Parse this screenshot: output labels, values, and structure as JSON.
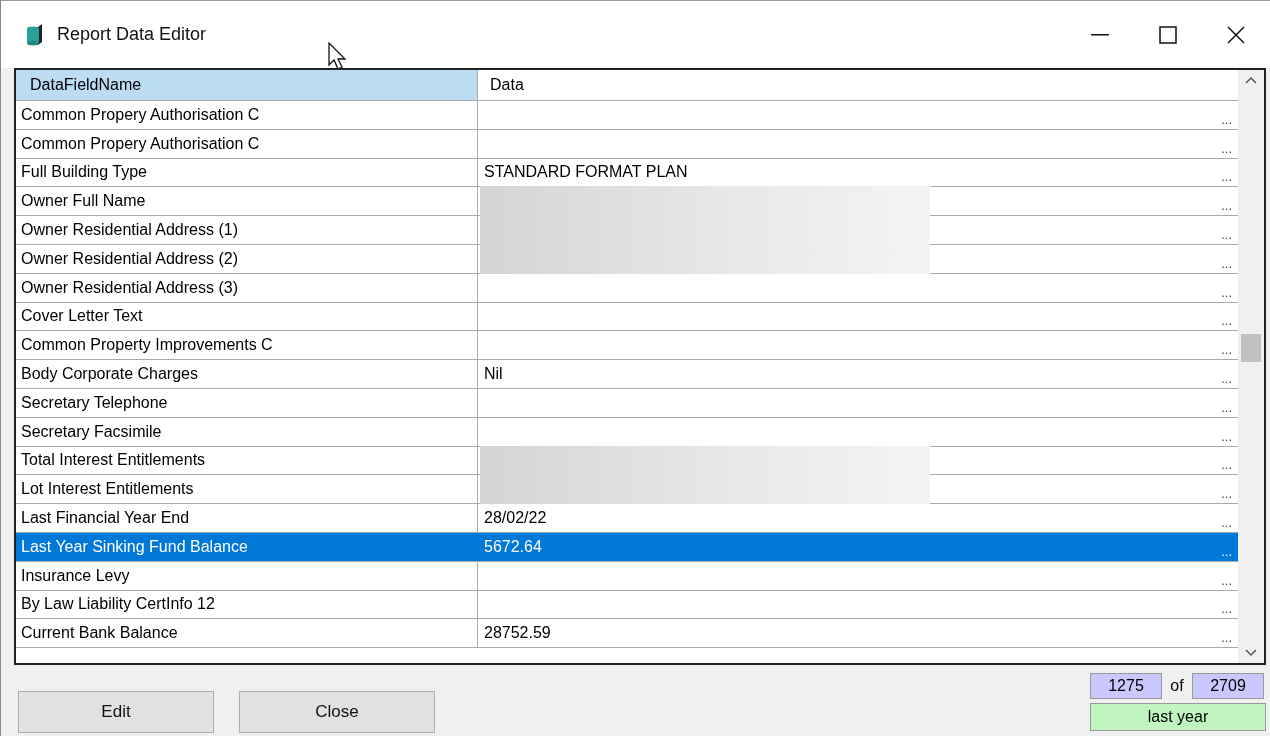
{
  "window": {
    "title": "Report Data Editor"
  },
  "table": {
    "columns": [
      "DataFieldName",
      "Data"
    ],
    "rows": [
      {
        "name": "Common Propery Authorisation C",
        "data": "",
        "selected": false,
        "redacted": false
      },
      {
        "name": "Common Propery Authorisation C",
        "data": "",
        "selected": false,
        "redacted": false
      },
      {
        "name": "Full Building Type",
        "data": "STANDARD FORMAT PLAN",
        "selected": false,
        "redacted": false
      },
      {
        "name": "Owner Full Name",
        "data": "",
        "selected": false,
        "redacted": true
      },
      {
        "name": "Owner Residential Address (1)",
        "data": "",
        "selected": false,
        "redacted": true
      },
      {
        "name": "Owner Residential Address (2)",
        "data": "",
        "selected": false,
        "redacted": true
      },
      {
        "name": "Owner Residential Address (3)",
        "data": "",
        "selected": false,
        "redacted": false
      },
      {
        "name": "Cover Letter Text",
        "data": "",
        "selected": false,
        "redacted": false
      },
      {
        "name": "Common Property Improvements C",
        "data": "",
        "selected": false,
        "redacted": false
      },
      {
        "name": "Body Corporate Charges",
        "data": "Nil",
        "selected": false,
        "redacted": false
      },
      {
        "name": "Secretary Telephone",
        "data": "",
        "selected": false,
        "redacted": false
      },
      {
        "name": "Secretary Facsimile",
        "data": "",
        "selected": false,
        "redacted": false
      },
      {
        "name": "Total Interest Entitlements",
        "data": "",
        "selected": false,
        "redacted": true
      },
      {
        "name": "Lot Interest Entitlements",
        "data": "",
        "selected": false,
        "redacted": true
      },
      {
        "name": "Last Financial Year End",
        "data": "28/02/22",
        "selected": false,
        "redacted": false
      },
      {
        "name": "Last Year Sinking Fund Balance",
        "data": "5672.64",
        "selected": true,
        "redacted": false
      },
      {
        "name": "Insurance Levy",
        "data": "",
        "selected": false,
        "redacted": false
      },
      {
        "name": "By Law Liability CertInfo 12",
        "data": "",
        "selected": false,
        "redacted": false
      },
      {
        "name": "Current Bank Balance",
        "data": "28752.59",
        "selected": false,
        "redacted": false
      }
    ],
    "cell_button": "..."
  },
  "buttons": [
    "Edit",
    "Close"
  ],
  "record": {
    "current": "1275",
    "of": "of",
    "total": "2709",
    "filter": "last year"
  }
}
